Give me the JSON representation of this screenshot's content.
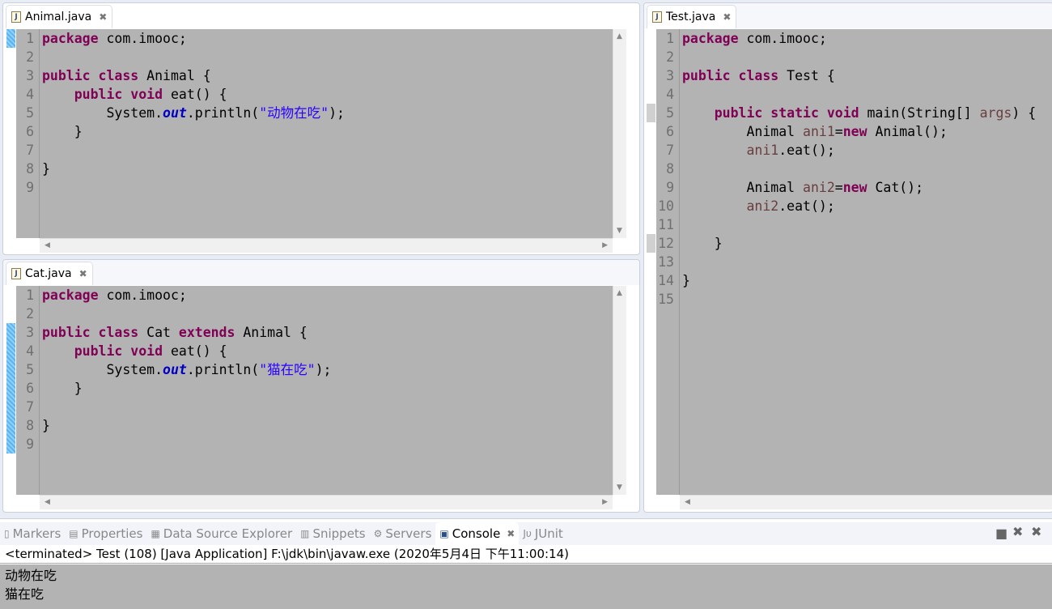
{
  "editors": [
    {
      "tab": "Animal.java",
      "lines": [
        [
          [
            "kw",
            "package"
          ],
          [
            "t",
            " com.imooc;"
          ]
        ],
        [],
        [
          [
            "kw",
            "public class"
          ],
          [
            "t",
            " Animal {"
          ]
        ],
        [
          [
            "t",
            "    "
          ],
          [
            "kw",
            "public void"
          ],
          [
            "t",
            " eat() {"
          ]
        ],
        [
          [
            "t",
            "        System."
          ],
          [
            "fld",
            "out"
          ],
          [
            "t",
            ".println("
          ],
          [
            "str",
            "\"动物在吃\""
          ],
          [
            "t",
            ");"
          ]
        ],
        [
          [
            "t",
            "    }"
          ]
        ],
        [],
        [
          [
            "t",
            "}"
          ]
        ],
        []
      ]
    },
    {
      "tab": "Cat.java",
      "lines": [
        [
          [
            "kw",
            "package"
          ],
          [
            "t",
            " com.imooc;"
          ]
        ],
        [],
        [
          [
            "kw",
            "public class"
          ],
          [
            "t",
            " Cat "
          ],
          [
            "kw",
            "extends"
          ],
          [
            "t",
            " Animal {"
          ]
        ],
        [
          [
            "t",
            "    "
          ],
          [
            "kw",
            "public void"
          ],
          [
            "t",
            " eat() {"
          ]
        ],
        [
          [
            "t",
            "        System."
          ],
          [
            "fld",
            "out"
          ],
          [
            "t",
            ".println("
          ],
          [
            "str",
            "\"猫在吃\""
          ],
          [
            "t",
            ");"
          ]
        ],
        [
          [
            "t",
            "    }"
          ]
        ],
        [],
        [
          [
            "t",
            "}"
          ]
        ],
        []
      ]
    },
    {
      "tab": "Test.java",
      "lines": [
        [
          [
            "kw",
            "package"
          ],
          [
            "t",
            " com.imooc;"
          ]
        ],
        [],
        [
          [
            "kw",
            "public class"
          ],
          [
            "t",
            " Test {"
          ]
        ],
        [],
        [
          [
            "t",
            "    "
          ],
          [
            "kw",
            "public static void"
          ],
          [
            "t",
            " main(String[] "
          ],
          [
            "var",
            "args"
          ],
          [
            "t",
            ") {"
          ]
        ],
        [
          [
            "t",
            "        Animal "
          ],
          [
            "var",
            "ani1"
          ],
          [
            "t",
            "="
          ],
          [
            "kw",
            "new"
          ],
          [
            "t",
            " Animal();"
          ]
        ],
        [
          [
            "t",
            "        "
          ],
          [
            "var",
            "ani1"
          ],
          [
            "t",
            ".eat();"
          ]
        ],
        [],
        [
          [
            "t",
            "        Animal "
          ],
          [
            "var",
            "ani2"
          ],
          [
            "t",
            "="
          ],
          [
            "kw",
            "new"
          ],
          [
            "t",
            " Cat();"
          ]
        ],
        [
          [
            "t",
            "        "
          ],
          [
            "var",
            "ani2"
          ],
          [
            "t",
            ".eat();"
          ]
        ],
        [],
        [
          [
            "t",
            "    }"
          ]
        ],
        [],
        [
          [
            "t",
            "}"
          ]
        ],
        []
      ]
    }
  ],
  "bottom": {
    "tabs": [
      {
        "label": "Markers",
        "icon": "markers-icon",
        "glyph": "▯"
      },
      {
        "label": "Properties",
        "icon": "properties-icon",
        "glyph": "▤"
      },
      {
        "label": "Data Source Explorer",
        "icon": "data-source-icon",
        "glyph": "▦"
      },
      {
        "label": "Snippets",
        "icon": "snippets-icon",
        "glyph": "▥"
      },
      {
        "label": "Servers",
        "icon": "servers-icon",
        "glyph": "⚙"
      },
      {
        "label": "Console",
        "icon": "console-icon",
        "glyph": "▣",
        "active": true
      },
      {
        "label": "JUnit",
        "icon": "junit-icon",
        "glyph": "Jυ"
      }
    ],
    "status": "<terminated> Test (108) [Java Application] F:\\jdk\\bin\\javaw.exe (2020年5月4日 下午11:00:14)",
    "output": [
      "动物在吃",
      "猫在吃"
    ]
  }
}
